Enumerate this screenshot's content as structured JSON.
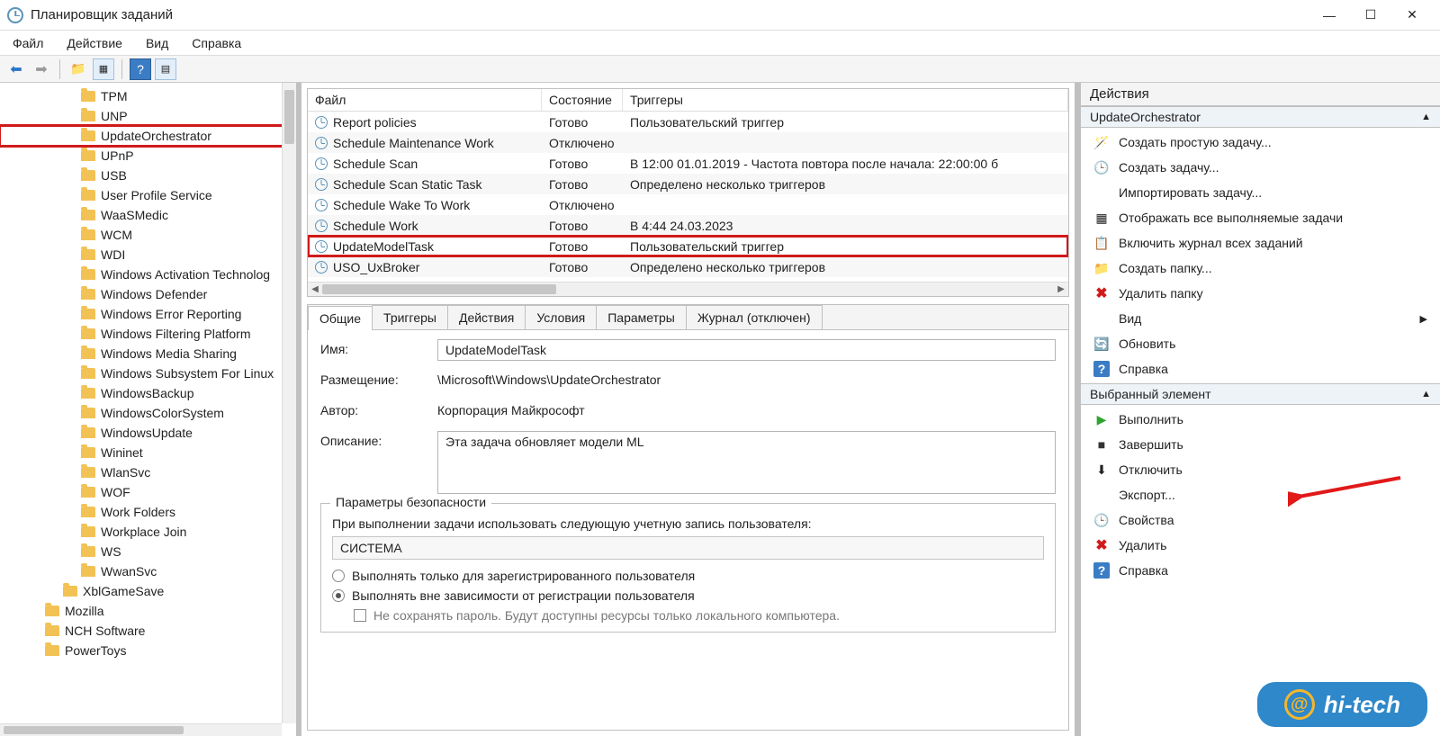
{
  "window": {
    "title": "Планировщик заданий"
  },
  "menu": {
    "file": "Файл",
    "action": "Действие",
    "view": "Вид",
    "help": "Справка"
  },
  "tree": [
    {
      "label": "TPM",
      "indent": 2
    },
    {
      "label": "UNP",
      "indent": 2
    },
    {
      "label": "UpdateOrchestrator",
      "indent": 2,
      "highlight": true
    },
    {
      "label": "UPnP",
      "indent": 2
    },
    {
      "label": "USB",
      "indent": 2
    },
    {
      "label": "User Profile Service",
      "indent": 2
    },
    {
      "label": "WaaSMedic",
      "indent": 2
    },
    {
      "label": "WCM",
      "indent": 2
    },
    {
      "label": "WDI",
      "indent": 2
    },
    {
      "label": "Windows Activation Technolog",
      "indent": 2
    },
    {
      "label": "Windows Defender",
      "indent": 2
    },
    {
      "label": "Windows Error Reporting",
      "indent": 2
    },
    {
      "label": "Windows Filtering Platform",
      "indent": 2
    },
    {
      "label": "Windows Media Sharing",
      "indent": 2
    },
    {
      "label": "Windows Subsystem For Linux",
      "indent": 2
    },
    {
      "label": "WindowsBackup",
      "indent": 2
    },
    {
      "label": "WindowsColorSystem",
      "indent": 2
    },
    {
      "label": "WindowsUpdate",
      "indent": 2
    },
    {
      "label": "Wininet",
      "indent": 2
    },
    {
      "label": "WlanSvc",
      "indent": 2
    },
    {
      "label": "WOF",
      "indent": 2
    },
    {
      "label": "Work Folders",
      "indent": 2
    },
    {
      "label": "Workplace Join",
      "indent": 2
    },
    {
      "label": "WS",
      "indent": 2
    },
    {
      "label": "WwanSvc",
      "indent": 2
    },
    {
      "label": "XblGameSave",
      "indent": 1
    },
    {
      "label": "Mozilla",
      "indent": 0
    },
    {
      "label": "NCH Software",
      "indent": 0
    },
    {
      "label": "PowerToys",
      "indent": 0
    }
  ],
  "taskList": {
    "columns": {
      "file": "Файл",
      "state": "Состояние",
      "triggers": "Триггеры"
    },
    "colWidths": {
      "file": 260,
      "state": 90
    },
    "rows": [
      {
        "name": "Report policies",
        "state": "Готово",
        "trigger": "Пользовательский триггер"
      },
      {
        "name": "Schedule Maintenance Work",
        "state": "Отключено",
        "trigger": ""
      },
      {
        "name": "Schedule Scan",
        "state": "Готово",
        "trigger": "В 12:00 01.01.2019 - Частота повтора после начала: 22:00:00 б"
      },
      {
        "name": "Schedule Scan Static Task",
        "state": "Готово",
        "trigger": "Определено несколько триггеров"
      },
      {
        "name": "Schedule Wake To Work",
        "state": "Отключено",
        "trigger": ""
      },
      {
        "name": "Schedule Work",
        "state": "Готово",
        "trigger": "В 4:44 24.03.2023"
      },
      {
        "name": "UpdateModelTask",
        "state": "Готово",
        "trigger": "Пользовательский триггер",
        "selected": true
      },
      {
        "name": "USO_UxBroker",
        "state": "Готово",
        "trigger": "Определено несколько триггеров"
      }
    ]
  },
  "tabs": {
    "general": "Общие",
    "triggers": "Триггеры",
    "actions": "Действия",
    "conditions": "Условия",
    "params": "Параметры",
    "log": "Журнал (отключен)"
  },
  "detail": {
    "labels": {
      "name": "Имя:",
      "location": "Размещение:",
      "author": "Автор:",
      "desc": "Описание:"
    },
    "name": "UpdateModelTask",
    "location": "\\Microsoft\\Windows\\UpdateOrchestrator",
    "author": "Корпорация Майкрософт",
    "desc": "Эта задача обновляет модели ML",
    "security": {
      "legend": "Параметры безопасности",
      "prompt": "При выполнении задачи использовать следующую учетную запись пользователя:",
      "account": "СИСТЕМА",
      "opt1": "Выполнять только для зарегистрированного пользователя",
      "opt2": "Выполнять вне зависимости от регистрации пользователя",
      "chk": "Не сохранять пароль. Будут доступны ресурсы только локального компьютера."
    }
  },
  "actions": {
    "title": "Действия",
    "section1": "UpdateOrchestrator",
    "items1": [
      {
        "ico": "wizard",
        "label": "Создать простую задачу..."
      },
      {
        "ico": "task",
        "label": "Создать задачу..."
      },
      {
        "ico": "",
        "label": "Импортировать задачу..."
      },
      {
        "ico": "grid",
        "label": "Отображать все выполняемые задачи"
      },
      {
        "ico": "log",
        "label": "Включить журнал всех заданий"
      },
      {
        "ico": "newf",
        "label": "Создать папку..."
      },
      {
        "ico": "delf",
        "label": "Удалить папку",
        "danger": true
      },
      {
        "ico": "",
        "label": "Вид",
        "arrow": true
      },
      {
        "ico": "refresh",
        "label": "Обновить"
      },
      {
        "ico": "help",
        "label": "Справка"
      }
    ],
    "section2": "Выбранный элемент",
    "items2": [
      {
        "ico": "play",
        "label": "Выполнить"
      },
      {
        "ico": "stop",
        "label": "Завершить"
      },
      {
        "ico": "off",
        "label": "Отключить"
      },
      {
        "ico": "",
        "label": "Экспорт..."
      },
      {
        "ico": "prop",
        "label": "Свойства"
      },
      {
        "ico": "del",
        "label": "Удалить",
        "danger": true
      },
      {
        "ico": "help",
        "label": "Справка"
      }
    ]
  },
  "watermark": "hi-tech"
}
